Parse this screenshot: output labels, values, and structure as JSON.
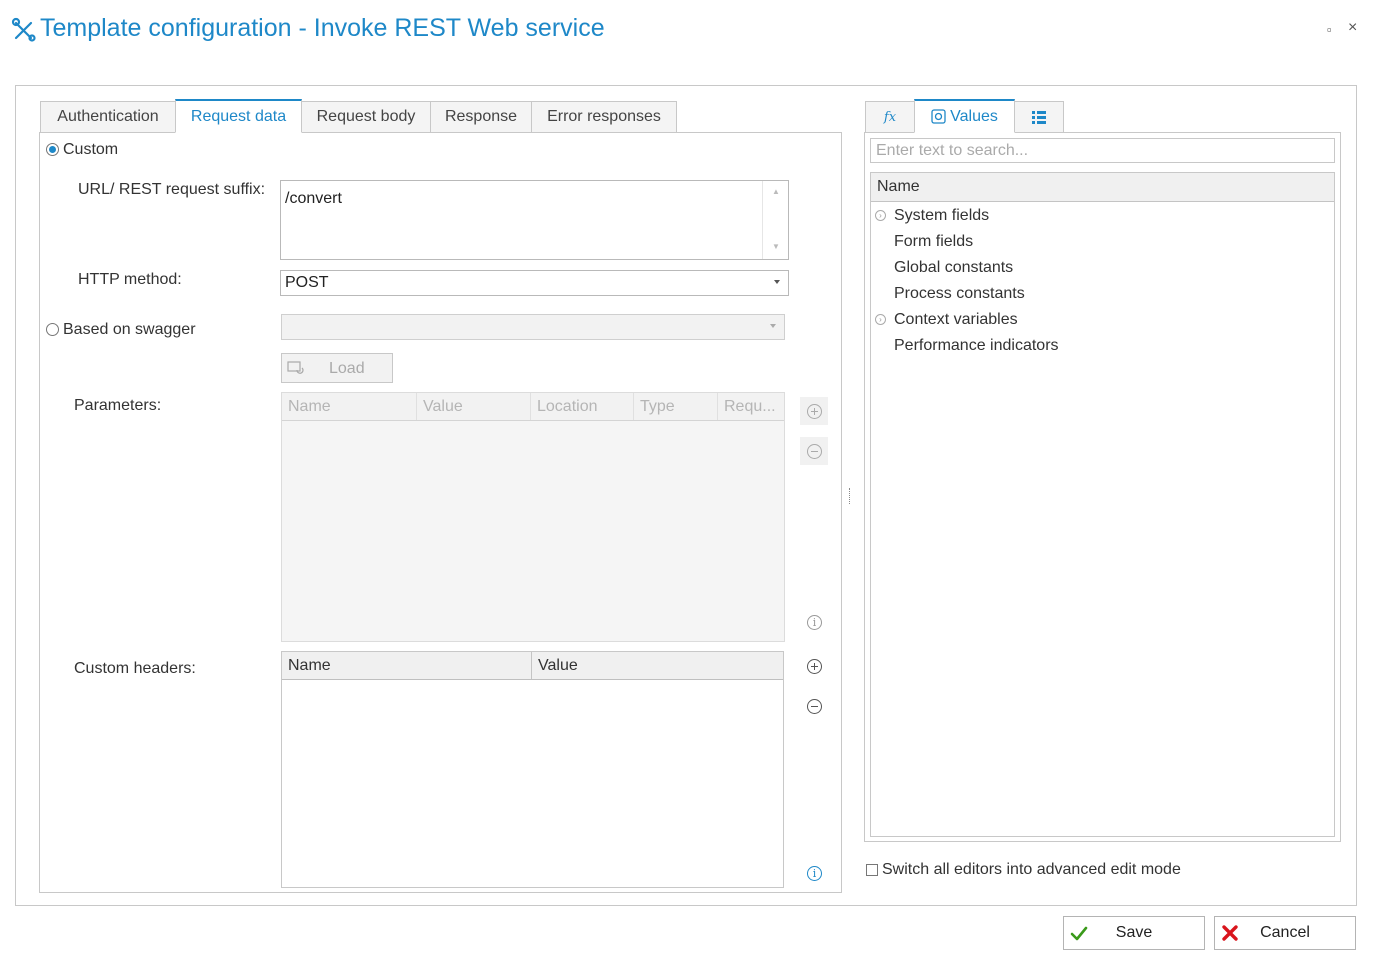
{
  "window": {
    "title": "Template configuration - Invoke REST Web service",
    "maximize_glyph": "▫",
    "close_glyph": "×"
  },
  "left_tabs": [
    {
      "label": "Authentication",
      "active": false
    },
    {
      "label": "Request data",
      "active": true
    },
    {
      "label": "Request body",
      "active": false
    },
    {
      "label": "Response",
      "active": false
    },
    {
      "label": "Error responses",
      "active": false
    }
  ],
  "request_data": {
    "custom_radio_label": "Custom",
    "custom_selected": true,
    "url_label": "URL/ REST request suffix:",
    "url_value": "/convert",
    "http_method_label": "HTTP method:",
    "http_method_value": "POST",
    "swagger_radio_label": "Based on swagger",
    "swagger_selected": false,
    "swagger_value": "",
    "load_button_label": "Load",
    "parameters_label": "Parameters:",
    "parameters_columns": [
      "Name",
      "Value",
      "Location",
      "Type",
      "Requ..."
    ],
    "custom_headers_label": "Custom headers:",
    "custom_headers_columns": [
      "Name",
      "Value"
    ]
  },
  "right_tabs": [
    {
      "label": "",
      "icon": "function-icon",
      "active": false
    },
    {
      "label": "Values",
      "icon": "values-icon",
      "active": true
    },
    {
      "label": "",
      "icon": "list-icon",
      "active": false
    }
  ],
  "values_panel": {
    "search_placeholder": "Enter text to search...",
    "tree_header": "Name",
    "items": [
      {
        "label": "System fields",
        "expandable": true
      },
      {
        "label": "Form fields",
        "expandable": false
      },
      {
        "label": "Global constants",
        "expandable": false
      },
      {
        "label": "Process constants",
        "expandable": false
      },
      {
        "label": "Context variables",
        "expandable": true
      },
      {
        "label": "Performance indicators",
        "expandable": false
      }
    ]
  },
  "advanced_mode_label": "Switch all editors into advanced edit mode",
  "advanced_mode_checked": false,
  "buttons": {
    "save": "Save",
    "cancel": "Cancel"
  },
  "colors": {
    "accent": "#1e88c8",
    "save_check": "#3a9a1a",
    "cancel_x": "#d9141c"
  }
}
